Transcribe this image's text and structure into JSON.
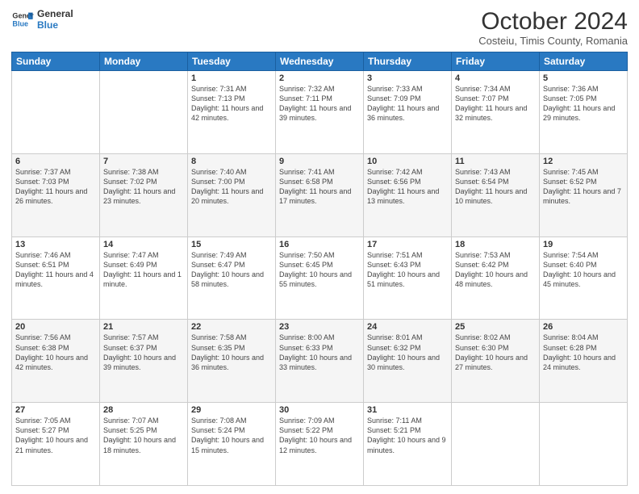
{
  "header": {
    "logo_line1": "General",
    "logo_line2": "Blue",
    "month": "October 2024",
    "location": "Costeiu, Timis County, Romania"
  },
  "days_of_week": [
    "Sunday",
    "Monday",
    "Tuesday",
    "Wednesday",
    "Thursday",
    "Friday",
    "Saturday"
  ],
  "weeks": [
    [
      {
        "day": "",
        "info": ""
      },
      {
        "day": "",
        "info": ""
      },
      {
        "day": "1",
        "info": "Sunrise: 7:31 AM\nSunset: 7:13 PM\nDaylight: 11 hours and 42 minutes."
      },
      {
        "day": "2",
        "info": "Sunrise: 7:32 AM\nSunset: 7:11 PM\nDaylight: 11 hours and 39 minutes."
      },
      {
        "day": "3",
        "info": "Sunrise: 7:33 AM\nSunset: 7:09 PM\nDaylight: 11 hours and 36 minutes."
      },
      {
        "day": "4",
        "info": "Sunrise: 7:34 AM\nSunset: 7:07 PM\nDaylight: 11 hours and 32 minutes."
      },
      {
        "day": "5",
        "info": "Sunrise: 7:36 AM\nSunset: 7:05 PM\nDaylight: 11 hours and 29 minutes."
      }
    ],
    [
      {
        "day": "6",
        "info": "Sunrise: 7:37 AM\nSunset: 7:03 PM\nDaylight: 11 hours and 26 minutes."
      },
      {
        "day": "7",
        "info": "Sunrise: 7:38 AM\nSunset: 7:02 PM\nDaylight: 11 hours and 23 minutes."
      },
      {
        "day": "8",
        "info": "Sunrise: 7:40 AM\nSunset: 7:00 PM\nDaylight: 11 hours and 20 minutes."
      },
      {
        "day": "9",
        "info": "Sunrise: 7:41 AM\nSunset: 6:58 PM\nDaylight: 11 hours and 17 minutes."
      },
      {
        "day": "10",
        "info": "Sunrise: 7:42 AM\nSunset: 6:56 PM\nDaylight: 11 hours and 13 minutes."
      },
      {
        "day": "11",
        "info": "Sunrise: 7:43 AM\nSunset: 6:54 PM\nDaylight: 11 hours and 10 minutes."
      },
      {
        "day": "12",
        "info": "Sunrise: 7:45 AM\nSunset: 6:52 PM\nDaylight: 11 hours and 7 minutes."
      }
    ],
    [
      {
        "day": "13",
        "info": "Sunrise: 7:46 AM\nSunset: 6:51 PM\nDaylight: 11 hours and 4 minutes."
      },
      {
        "day": "14",
        "info": "Sunrise: 7:47 AM\nSunset: 6:49 PM\nDaylight: 11 hours and 1 minute."
      },
      {
        "day": "15",
        "info": "Sunrise: 7:49 AM\nSunset: 6:47 PM\nDaylight: 10 hours and 58 minutes."
      },
      {
        "day": "16",
        "info": "Sunrise: 7:50 AM\nSunset: 6:45 PM\nDaylight: 10 hours and 55 minutes."
      },
      {
        "day": "17",
        "info": "Sunrise: 7:51 AM\nSunset: 6:43 PM\nDaylight: 10 hours and 51 minutes."
      },
      {
        "day": "18",
        "info": "Sunrise: 7:53 AM\nSunset: 6:42 PM\nDaylight: 10 hours and 48 minutes."
      },
      {
        "day": "19",
        "info": "Sunrise: 7:54 AM\nSunset: 6:40 PM\nDaylight: 10 hours and 45 minutes."
      }
    ],
    [
      {
        "day": "20",
        "info": "Sunrise: 7:56 AM\nSunset: 6:38 PM\nDaylight: 10 hours and 42 minutes."
      },
      {
        "day": "21",
        "info": "Sunrise: 7:57 AM\nSunset: 6:37 PM\nDaylight: 10 hours and 39 minutes."
      },
      {
        "day": "22",
        "info": "Sunrise: 7:58 AM\nSunset: 6:35 PM\nDaylight: 10 hours and 36 minutes."
      },
      {
        "day": "23",
        "info": "Sunrise: 8:00 AM\nSunset: 6:33 PM\nDaylight: 10 hours and 33 minutes."
      },
      {
        "day": "24",
        "info": "Sunrise: 8:01 AM\nSunset: 6:32 PM\nDaylight: 10 hours and 30 minutes."
      },
      {
        "day": "25",
        "info": "Sunrise: 8:02 AM\nSunset: 6:30 PM\nDaylight: 10 hours and 27 minutes."
      },
      {
        "day": "26",
        "info": "Sunrise: 8:04 AM\nSunset: 6:28 PM\nDaylight: 10 hours and 24 minutes."
      }
    ],
    [
      {
        "day": "27",
        "info": "Sunrise: 7:05 AM\nSunset: 5:27 PM\nDaylight: 10 hours and 21 minutes."
      },
      {
        "day": "28",
        "info": "Sunrise: 7:07 AM\nSunset: 5:25 PM\nDaylight: 10 hours and 18 minutes."
      },
      {
        "day": "29",
        "info": "Sunrise: 7:08 AM\nSunset: 5:24 PM\nDaylight: 10 hours and 15 minutes."
      },
      {
        "day": "30",
        "info": "Sunrise: 7:09 AM\nSunset: 5:22 PM\nDaylight: 10 hours and 12 minutes."
      },
      {
        "day": "31",
        "info": "Sunrise: 7:11 AM\nSunset: 5:21 PM\nDaylight: 10 hours and 9 minutes."
      },
      {
        "day": "",
        "info": ""
      },
      {
        "day": "",
        "info": ""
      }
    ]
  ]
}
